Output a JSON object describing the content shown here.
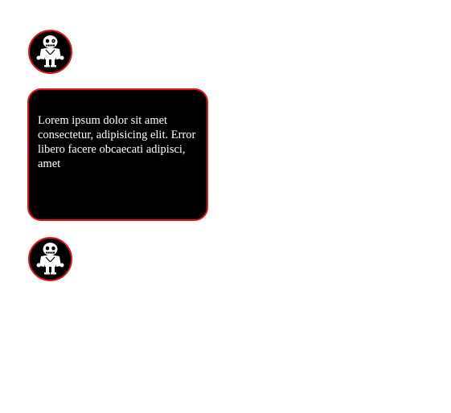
{
  "avatars": [
    {
      "icon": "skeleton-avatar-icon"
    },
    {
      "icon": "skeleton-avatar-icon"
    }
  ],
  "message": {
    "text": "Lorem ipsum dolor sit amet consectetur, adipisicing elit. Error libero facere obcaecati adipisci, amet"
  },
  "colors": {
    "border": "#e8141d",
    "bubble_bg": "#000000",
    "text": "#ffffff",
    "page_bg": "#ffffff"
  }
}
